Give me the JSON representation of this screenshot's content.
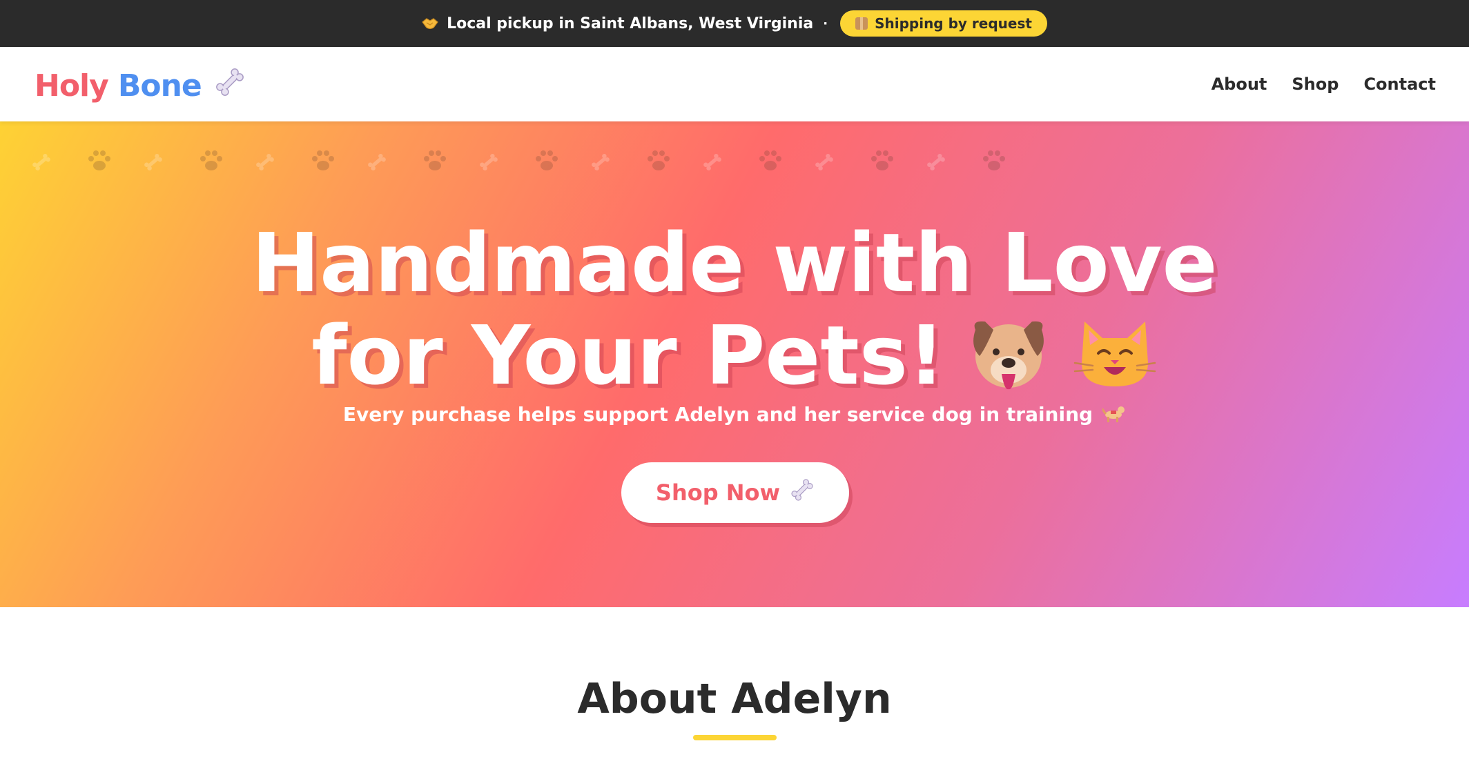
{
  "topbar": {
    "pickup_text": "Local pickup in Saint Albans, West Virginia",
    "separator": "·",
    "shipping_badge": "Shipping by request",
    "icons": [
      "handshake-icon",
      "package-icon"
    ]
  },
  "header": {
    "logo_word1": "Holy",
    "logo_word2": "Bone",
    "logo_icon": "bone-icon",
    "nav": [
      "About",
      "Shop",
      "Contact"
    ]
  },
  "hero": {
    "title_line1": "Handmade with Love",
    "title_line2": "for Your Pets!",
    "title_icons": [
      "dog-face-icon",
      "cat-face-icon"
    ],
    "pattern_icons": [
      "bone-icon",
      "paw-icon"
    ],
    "subtitle": "Every purchase helps support Adelyn and her service dog in training",
    "subtitle_icon": "service-dog-icon",
    "cta_label": "Shop Now",
    "cta_icon": "bone-icon"
  },
  "about": {
    "title": "About Adelyn"
  },
  "colors": {
    "topbar_bg": "#2b2b2b",
    "badge_bg": "#fcd535",
    "logo_pink": "#f25f6b",
    "logo_blue": "#4f8ff0",
    "gradient": [
      "#fed234",
      "#fe9c56",
      "#ff6b6b",
      "#ec6f9b",
      "#c77dff"
    ],
    "underline": "#fcd535"
  }
}
